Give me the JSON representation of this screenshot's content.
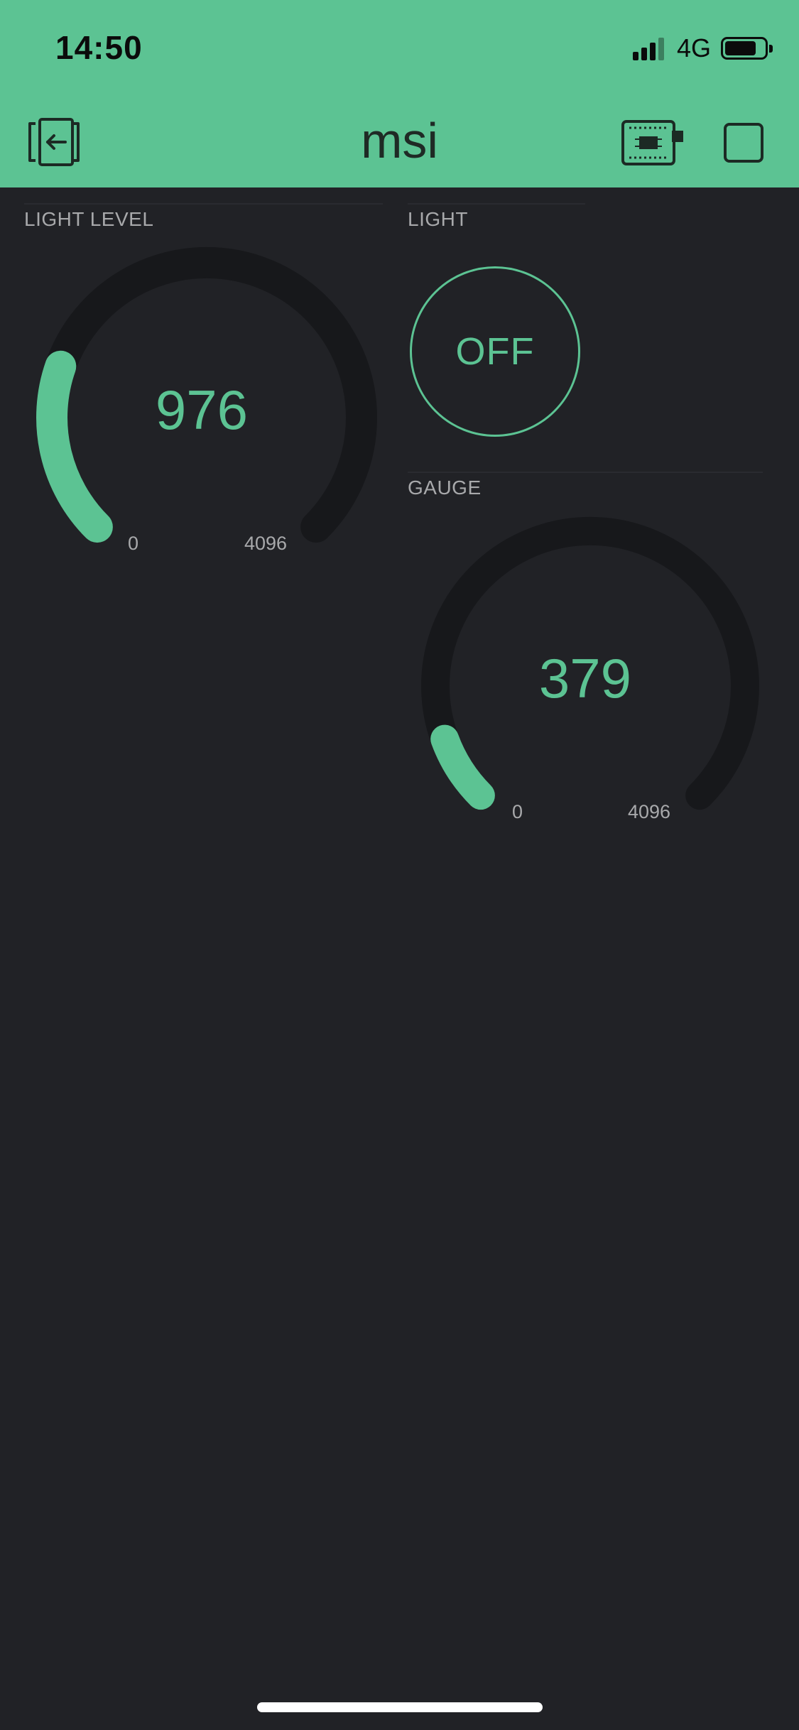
{
  "status_bar": {
    "time": "14:50",
    "network": "4G",
    "signal_bars": 4,
    "signal_bars_active": 3,
    "battery_level": 0.8
  },
  "header": {
    "title": "msi",
    "icons": {
      "exit": "exit-icon",
      "device": "device-chip-icon",
      "stop": "stop-icon"
    }
  },
  "widgets": {
    "light_level": {
      "label": "LIGHT LEVEL",
      "value": "976",
      "min": "0",
      "max": "4096"
    },
    "light": {
      "label": "LIGHT",
      "state": "OFF"
    },
    "gauge": {
      "label": "GAUGE",
      "value": "379",
      "min": "0",
      "max": "4096"
    }
  },
  "colors": {
    "accent": "#5cc393",
    "background": "#212226",
    "track": "#17181b",
    "label": "#a8a9ab"
  }
}
